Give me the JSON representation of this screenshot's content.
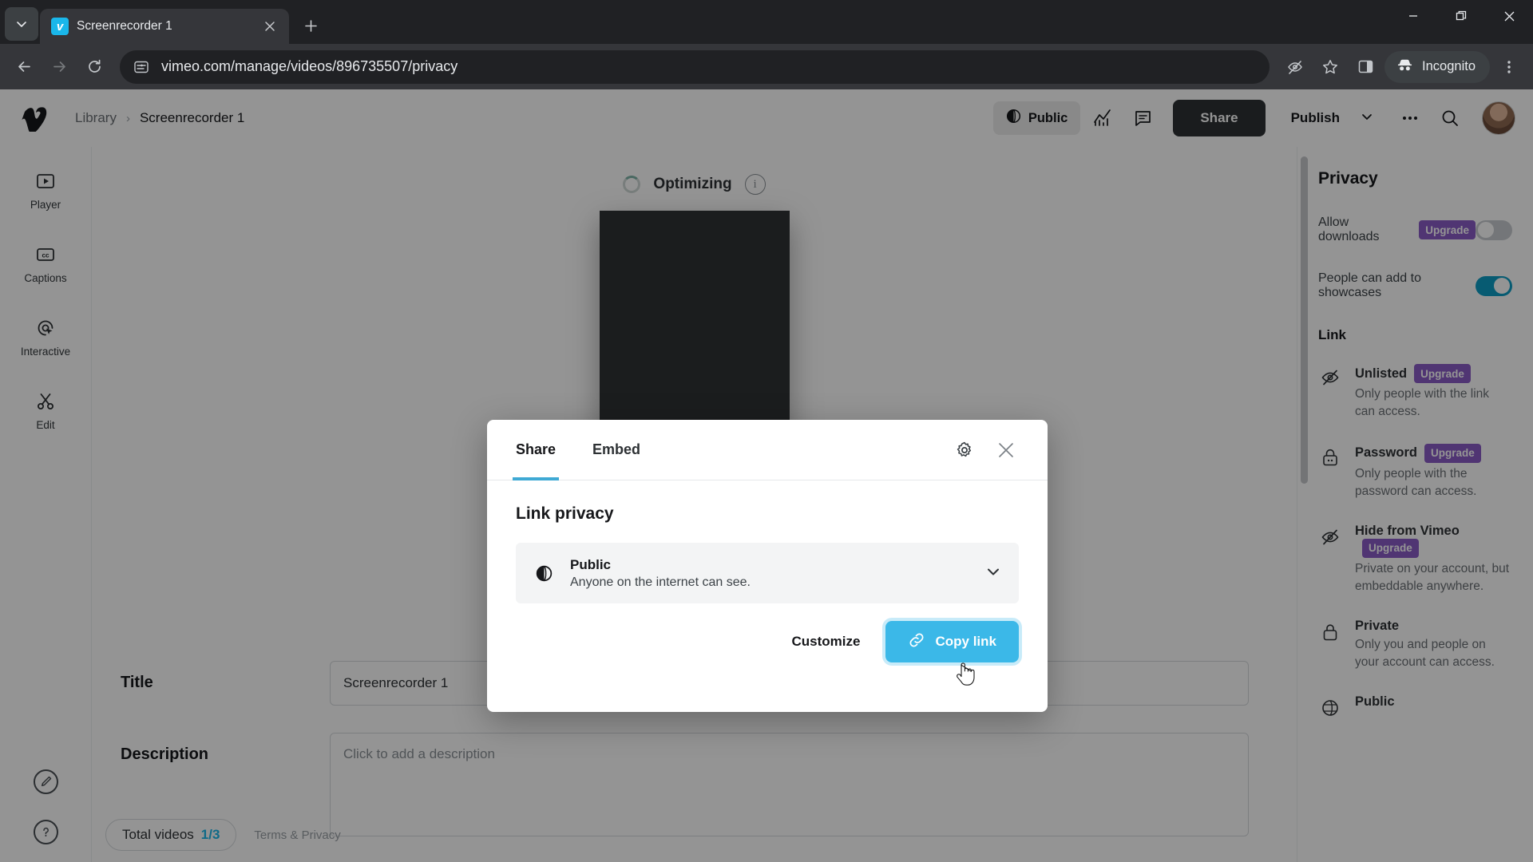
{
  "browser": {
    "tab": {
      "title": "Screenrecorder 1",
      "favicon": "vimeo-icon",
      "close": "close-icon"
    },
    "tab_search_icon": "chevron-down-icon",
    "new_tab_icon": "plus-icon",
    "window": {
      "minimize": "minimize-icon",
      "maximize": "maximize-icon",
      "close": "close-icon"
    },
    "nav": {
      "back": "back-arrow-icon",
      "forward": "forward-arrow-icon",
      "reload": "reload-icon"
    },
    "omnibox": {
      "site_info_icon": "site-settings-icon",
      "url": "vimeo.com/manage/videos/896735507/privacy"
    },
    "actions": {
      "tracking_icon": "eye-off-icon",
      "bookmark_icon": "star-icon",
      "sidepanel_icon": "side-panel-icon",
      "menu_icon": "three-dots-vertical-icon"
    },
    "incognito": {
      "label": "Incognito",
      "icon": "incognito-hat-icon"
    }
  },
  "header": {
    "logo": "vimeo-logo",
    "breadcrumb": {
      "library": "Library",
      "separator": "›",
      "current": "Screenrecorder 1"
    },
    "privacy_pill": {
      "label": "Public",
      "icon": "globe-icon"
    },
    "stats_icon": "analytics-icon",
    "comments_icon": "comment-icon",
    "share_button": "Share",
    "publish_button": "Publish",
    "publish_chevron": "chevron-down-icon",
    "more_icon": "three-dots-icon",
    "search_icon": "search-icon",
    "avatar": "user-avatar"
  },
  "rail": {
    "items": [
      {
        "label": "Player",
        "icon": "player-icon"
      },
      {
        "label": "Captions",
        "icon": "captions-cc-icon"
      },
      {
        "label": "Interactive",
        "icon": "interactive-cursor-icon"
      },
      {
        "label": "Edit",
        "icon": "scissors-icon"
      }
    ],
    "bottom": [
      {
        "icon": "feedback-pencil-icon"
      },
      {
        "icon": "help-question-icon"
      }
    ]
  },
  "main": {
    "status": {
      "text": "Optimizing",
      "spinner": "loading-spinner",
      "info_icon": "info-icon"
    },
    "thumbnail": "video-thumbnail",
    "fields": [
      {
        "label": "Title",
        "value": "Screenrecorder 1",
        "placeholder": "",
        "type": "input"
      },
      {
        "label": "Description",
        "value": "",
        "placeholder": "Click to add a description",
        "type": "textarea"
      }
    ],
    "footer": {
      "total_videos_label": "Total videos",
      "total_videos_count": "1/3",
      "terms": "Terms & Privacy"
    }
  },
  "right_panel": {
    "title": "Privacy",
    "toggles": [
      {
        "label": "Allow downloads",
        "badge": "Upgrade",
        "state": "off"
      },
      {
        "label": "People can add to showcases",
        "badge": "",
        "state": "on"
      }
    ],
    "section": "Link",
    "options": [
      {
        "title": "Unlisted",
        "badge": "Upgrade",
        "desc": "Only people with the link can access.",
        "icon": "eye-off-icon"
      },
      {
        "title": "Password",
        "badge": "Upgrade",
        "desc": "Only people with the password can access.",
        "icon": "lock-keyhole-icon"
      },
      {
        "title": "Hide from Vimeo",
        "badge": "Upgrade",
        "desc": "Private on your account, but embeddable anywhere.",
        "icon": "eye-off-icon"
      },
      {
        "title": "Private",
        "badge": "",
        "desc": "Only you and people on your account can access.",
        "icon": "lock-icon"
      },
      {
        "title": "Public",
        "badge": "",
        "desc": "",
        "icon": "globe-icon"
      }
    ]
  },
  "modal": {
    "tabs": [
      {
        "label": "Share",
        "active": true
      },
      {
        "label": "Embed",
        "active": false
      }
    ],
    "settings_icon": "gear-icon",
    "close_icon": "close-icon",
    "heading": "Link privacy",
    "selected": {
      "icon": "globe-icon",
      "title": "Public",
      "desc": "Anyone on the internet can see.",
      "chevron": "chevron-down-icon"
    },
    "customize_button": "Customize",
    "copy_button": {
      "label": "Copy link",
      "icon": "link-chain-icon"
    }
  },
  "colors": {
    "accent_blue": "#3bb8e8",
    "tab_underline": "#3fa9d4",
    "upgrade_purple": "#8b5cc7",
    "toggle_on": "#0d9dc4",
    "share_dark": "#2d3134"
  }
}
